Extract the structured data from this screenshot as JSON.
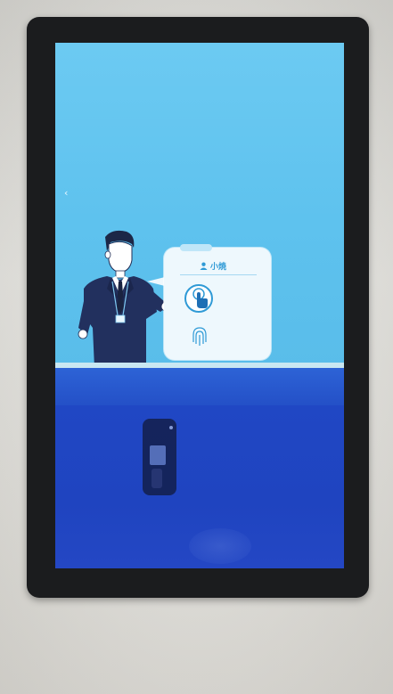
{
  "device": {
    "bezel_color": "#1b1c1e",
    "wall_color": "#dedcd6"
  },
  "screen": {
    "back_icon": "chevron-left-icon",
    "instruction_text": "",
    "colors": {
      "top_background": "#5cc3ee",
      "bottom_background": "#2047c4",
      "accent": "#2f9ad6"
    }
  },
  "card": {
    "title": "小焼",
    "title_icon": "user-icon",
    "options": [
      {
        "icon": "tap-hand-icon",
        "label": "",
        "sublabel": ""
      },
      {
        "icon": "fingerprint-icon",
        "label": ""
      }
    ]
  },
  "bottom_panel": {
    "corner_label": ""
  }
}
